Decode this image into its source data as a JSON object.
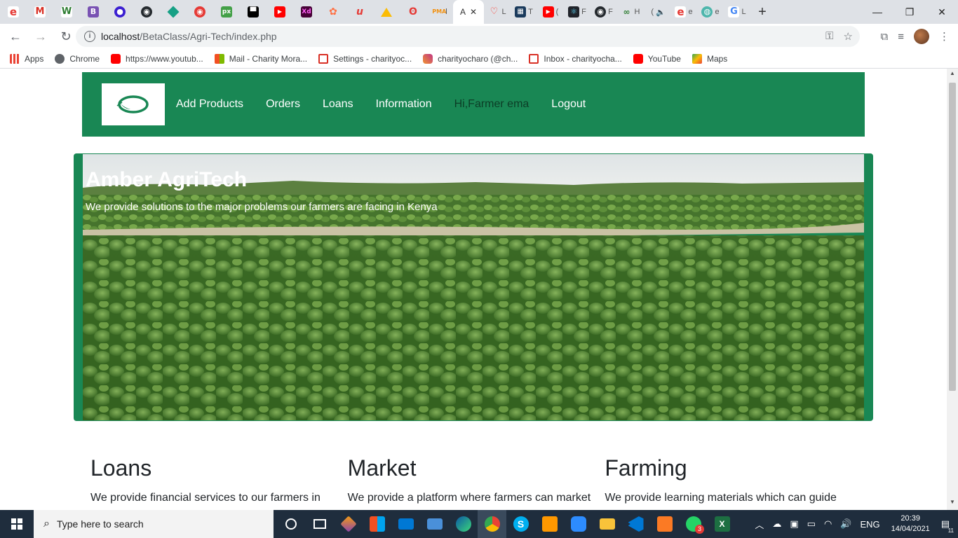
{
  "browser": {
    "active_tab_letter": "A",
    "url_host": "localhost",
    "url_path": "/BetaClass/Agri-Tech/index.php",
    "tab_letters": [
      "l",
      "L",
      "T",
      "(",
      "F",
      "F",
      "H",
      "(",
      "e",
      "e",
      "L"
    ],
    "bookmarks": [
      {
        "label": "Apps",
        "icon": "apps-grid-icon",
        "color": "#4285f4"
      },
      {
        "label": "Chrome",
        "icon": "chrome-icon",
        "color": "#5f6368"
      },
      {
        "label": "https://www.youtub...",
        "icon": "youtube-icon",
        "color": "#ff0000"
      },
      {
        "label": "Mail - Charity Mora...",
        "icon": "microsoft-icon",
        "color": "#f25022"
      },
      {
        "label": "Settings - charityoc...",
        "icon": "gmail-icon",
        "color": "#d93025"
      },
      {
        "label": "charityocharo (@ch...",
        "icon": "instagram-icon",
        "color": "#c13584"
      },
      {
        "label": "Inbox - charityocha...",
        "icon": "gmail-icon",
        "color": "#d93025"
      },
      {
        "label": "YouTube",
        "icon": "youtube-icon",
        "color": "#ff0000"
      },
      {
        "label": "Maps",
        "icon": "maps-icon",
        "color": "#34a853"
      }
    ]
  },
  "site": {
    "nav": {
      "links": [
        "Add Products",
        "Orders",
        "Loans",
        "Information"
      ],
      "greeting": "Hi,Farmer ema",
      "logout": "Logout"
    },
    "hero": {
      "title": "Amber AgriTech",
      "subtitle": "We provide solutions to the major problems our farmers are facing in Kenya"
    },
    "features": [
      {
        "heading": "Loans",
        "text": "We provide financial services to our farmers in"
      },
      {
        "heading": "Market",
        "text": "We provide a platform where farmers can market"
      },
      {
        "heading": "Farming",
        "text": "We provide learning materials which can guide"
      }
    ],
    "brand_color": "#198754"
  },
  "taskbar": {
    "search_placeholder": "Type here to search",
    "language": "ENG",
    "time": "20:39",
    "date": "14/04/2021",
    "notification_count": "11",
    "whatsapp_badge": "3"
  }
}
